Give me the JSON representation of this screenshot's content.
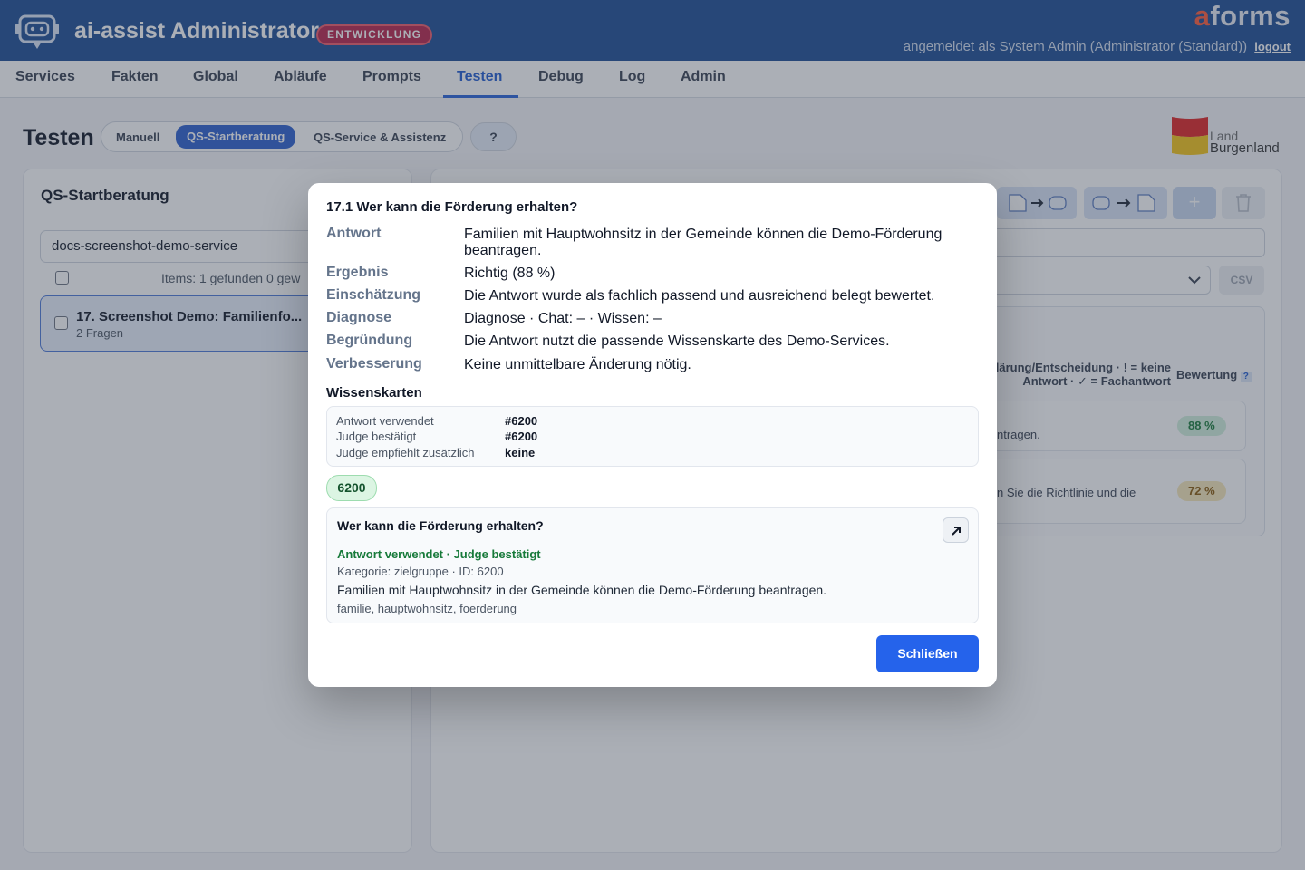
{
  "header": {
    "app_title": "ai-assist Administrator",
    "env_badge": "ENTWICKLUNG",
    "brand_a": "a",
    "brand_rest": "forms",
    "user_text": "angemeldet als System Admin (Administrator (Standard))",
    "logout_label": "logout"
  },
  "nav": {
    "items": [
      "Services",
      "Fakten",
      "Global",
      "Abläufe",
      "Prompts",
      "Testen",
      "Debug",
      "Log",
      "Admin"
    ],
    "active": "Testen"
  },
  "page": {
    "title": "Testen",
    "segments": [
      "Manuell",
      "QS-Startberatung",
      "QS-Service & Assistenz"
    ],
    "active_segment": "QS-Startberatung",
    "help_label": "?",
    "logo_line1": "Land",
    "logo_line2": "Burgenland"
  },
  "left_panel": {
    "title": "QS-Startberatung",
    "search_value": "docs-screenshot-demo-service",
    "items_info": "Items: 1 gefunden  0 gew",
    "list_item_title": "17. Screenshot Demo: Familienfo...",
    "list_item_sub": "2 Fragen"
  },
  "right_panel": {
    "csv_label": "CSV",
    "col_head_1": "lärung/Entscheidung · ! = keine Antwort · ✓ = Fachantwort",
    "col_head_2": "Bewertung",
    "col_head_help": "?",
    "rows": [
      {
        "text": "ntragen.",
        "score": "88 %"
      },
      {
        "text": "n Sie die Richtlinie und die",
        "score": "72 %"
      }
    ]
  },
  "modal": {
    "title": "17.1 Wer kann die Förderung erhalten?",
    "rows": [
      {
        "label": "Antwort",
        "value": "Familien mit Hauptwohnsitz in der Gemeinde können die Demo-Förderung beantragen."
      },
      {
        "label": "Ergebnis",
        "value": "Richtig (88 %)"
      },
      {
        "label": "Einschätzung",
        "value": "Die Antwort wurde als fachlich passend und ausreichend belegt bewertet."
      },
      {
        "label": "Diagnose",
        "value": "Diagnose · Chat: – · Wissen: –"
      },
      {
        "label": "Begründung",
        "value": "Die Antwort nutzt die passende Wissenskarte des Demo-Services."
      },
      {
        "label": "Verbesserung",
        "value": "Keine unmittelbare Änderung nötig."
      }
    ],
    "section_title": "Wissenskarten",
    "wk": [
      {
        "label": "Antwort verwendet",
        "value": "#6200"
      },
      {
        "label": "Judge bestätigt",
        "value": "#6200"
      },
      {
        "label": "Judge empfiehlt zusätzlich",
        "value": "keine"
      }
    ],
    "tag": "6200",
    "card": {
      "title": "Wer kann die Förderung erhalten?",
      "status": "Antwort verwendet · Judge bestätigt",
      "meta": "Kategorie: zielgruppe · ID: 6200",
      "text": "Familien mit Hauptwohnsitz in der Gemeinde können die Demo-Förderung beantragen.",
      "tags": "familie, hauptwohnsitz, foerderung"
    },
    "close_label": "Schließen"
  },
  "colors": {
    "header_bg": "#1c4d94",
    "accent": "#2563eb",
    "success": "#177a3a",
    "env_badge": "#b9234a"
  }
}
